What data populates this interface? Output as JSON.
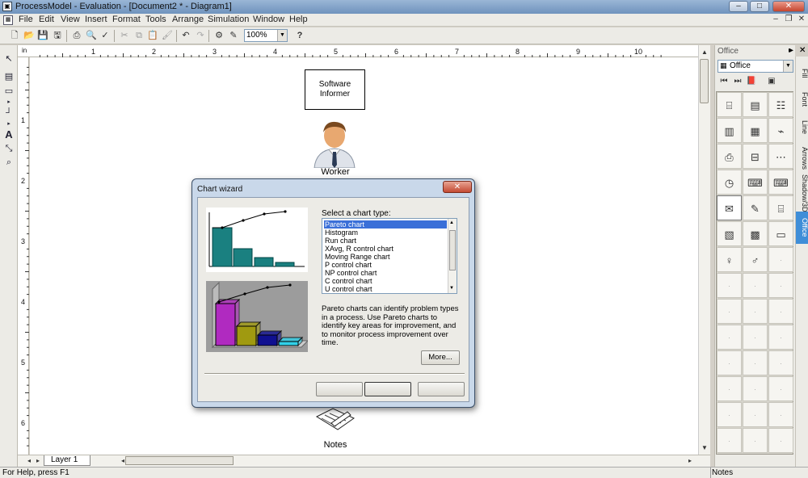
{
  "window": {
    "title": "ProcessModel - Evaluation - [Document2 * - Diagram1]"
  },
  "menubar": {
    "items": [
      "File",
      "Edit",
      "View",
      "Insert",
      "Format",
      "Tools",
      "Arrange",
      "Simulation",
      "Window",
      "Help"
    ]
  },
  "toolbar": {
    "zoom_value": "100%"
  },
  "ruler": {
    "unit": "in",
    "h_numbers": [
      "1",
      "2",
      "3",
      "4",
      "5",
      "6",
      "7",
      "8",
      "9",
      "10"
    ],
    "v_numbers": [
      "1",
      "2",
      "3",
      "4",
      "5",
      "6"
    ]
  },
  "canvas": {
    "shapes": {
      "software_box": [
        "Software",
        "Informer"
      ],
      "worker_label": "Worker",
      "notes_label": "Notes"
    }
  },
  "layer_tab": "Layer 1",
  "status": {
    "left": "For Help, press F1",
    "right": "Notes"
  },
  "right_panel": {
    "header": "Office",
    "selector_value": "Office",
    "tabs": [
      "Fill",
      "Font",
      "Line",
      "Arrows",
      "Shadow/3D",
      "Office"
    ],
    "active_tab": "Office",
    "icon_names": [
      "desk",
      "cabinet",
      "shelf",
      "partition",
      "safe",
      "phone",
      "printer",
      "copier",
      "router",
      "clock",
      "fax",
      "keyboard",
      "notes",
      "pencil",
      "typewriter",
      "server",
      "calculator",
      "scanner",
      "person-female",
      "person-male"
    ]
  },
  "dialog": {
    "title": "Chart wizard",
    "select_label": "Select a chart type:",
    "chart_types": [
      "Pareto chart",
      "Histogram",
      "Run chart",
      "XAvg, R control chart",
      "Moving Range chart",
      "P control chart",
      "NP control chart",
      "C control chart",
      "U control chart"
    ],
    "selected": "Pareto chart",
    "description": "Pareto charts can identify problem types in a process. Use Pareto charts to identify key areas for improvement, and to monitor process improvement over time.",
    "more_button": "More...",
    "preview_colors": {
      "teal": "#1a8080",
      "magenta": "#b02ac0",
      "olive": "#a09a10",
      "navy": "#101090",
      "cyan": "#30d0e8"
    }
  }
}
